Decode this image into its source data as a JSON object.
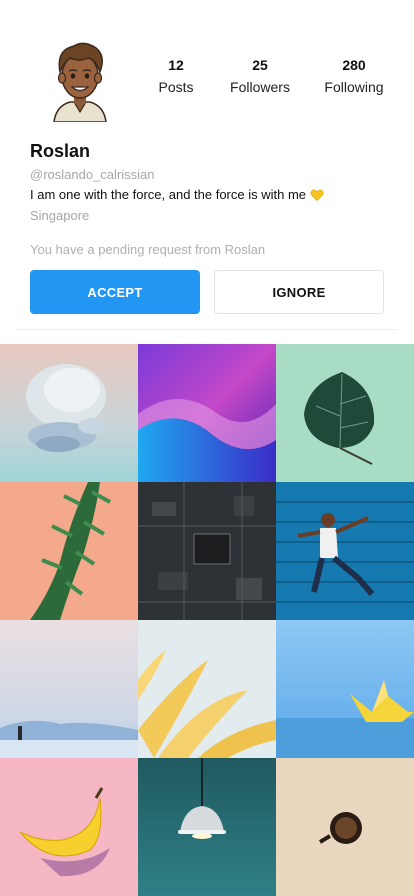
{
  "profile": {
    "name": "Roslan",
    "handle": "@roslando_calrissian",
    "bio": "I am one with the force, and the force is with me",
    "bio_emoji": "yellow-heart-icon",
    "location": "Singapore",
    "avatar_icon": "cartoon-avatar-icon"
  },
  "stats": [
    {
      "value": "12",
      "label": "Posts"
    },
    {
      "value": "25",
      "label": "Followers"
    },
    {
      "value": "280",
      "label": "Following"
    }
  ],
  "request": {
    "message": "You have a pending request from Roslan",
    "accept_label": "ACCEPT",
    "ignore_label": "IGNORE"
  },
  "colors": {
    "accent": "#2196f3",
    "muted_text": "#a7a7a7"
  },
  "grid": {
    "photos": [
      "abstract-3d-rings",
      "purple-blue-waves",
      "leaf-on-mint",
      "plant-on-peach",
      "circuit-board",
      "jumping-man-blue-wall",
      "person-on-salt-flats",
      "yellow-leaves",
      "paper-boat",
      "banana-on-pink",
      "pendant-lamp-teal",
      "coffee-cup-beige"
    ]
  }
}
